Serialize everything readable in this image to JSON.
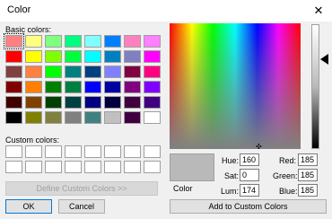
{
  "window": {
    "title": "Color",
    "close_glyph": "✕"
  },
  "labels": {
    "basic_colors": "Basic colors:",
    "custom_colors": "Custom colors:",
    "color": "Color"
  },
  "basic_colors": [
    "#ff8080",
    "#ffff80",
    "#80ff80",
    "#00ff80",
    "#80ffff",
    "#0080ff",
    "#ff80c0",
    "#ff80ff",
    "#ff0000",
    "#ffff00",
    "#80ff00",
    "#00ff40",
    "#00ffff",
    "#0080c0",
    "#8080c0",
    "#ff00ff",
    "#804040",
    "#ff8040",
    "#00ff00",
    "#008080",
    "#004080",
    "#8080ff",
    "#800040",
    "#ff0080",
    "#800000",
    "#ff8000",
    "#008000",
    "#008040",
    "#0000ff",
    "#0000a0",
    "#800080",
    "#8000ff",
    "#400000",
    "#804000",
    "#004000",
    "#004040",
    "#000080",
    "#000040",
    "#400040",
    "#400080",
    "#000000",
    "#808000",
    "#808040",
    "#808080",
    "#408080",
    "#c0c0c0",
    "#400040",
    "#ffffff"
  ],
  "custom_colors_count": 16,
  "buttons": {
    "define_custom": "Define Custom Colors >>",
    "ok": "OK",
    "cancel": "Cancel",
    "add_custom": "Add to Custom Colors"
  },
  "fields": {
    "hue": {
      "label": "Hue:",
      "value": "160"
    },
    "sat": {
      "label": "Sat:",
      "value": "0"
    },
    "lum": {
      "label": "Lum:",
      "value": "174"
    },
    "red": {
      "label": "Red:",
      "value": "185"
    },
    "green": {
      "label": "Green:",
      "value": "185"
    },
    "blue": {
      "label": "Blue:",
      "value": "185"
    }
  },
  "current_color": "#b9b9b9"
}
